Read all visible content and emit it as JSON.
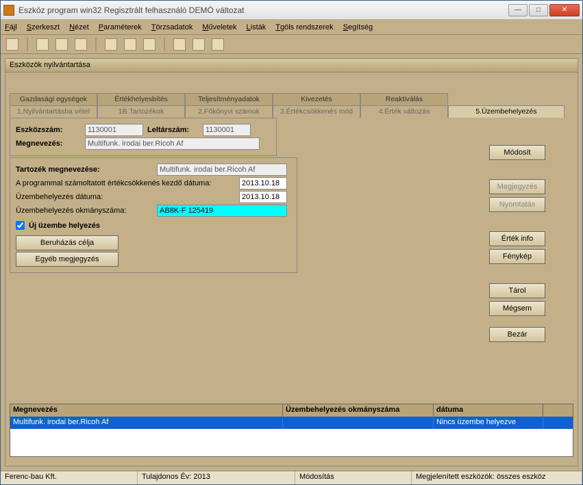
{
  "window": {
    "title": "Eszköz program win32 Regisztrált felhasználó  DEMÓ változat"
  },
  "menu": {
    "items": [
      {
        "u": "F",
        "rest": "ájl"
      },
      {
        "u": "S",
        "rest": "zerkeszt"
      },
      {
        "u": "N",
        "rest": "ézet"
      },
      {
        "u": "P",
        "rest": "araméterek"
      },
      {
        "u": "T",
        "rest": "örzsadatok"
      },
      {
        "u": "M",
        "rest": "űveletek"
      },
      {
        "u": "L",
        "rest": "isták"
      },
      {
        "u": "T",
        "rest": "göls rendszerek"
      },
      {
        "u": "S",
        "rest": "egítség"
      }
    ]
  },
  "panel": {
    "title": "Eszközök nyilvántartása"
  },
  "tabs_row1": [
    "Gazdasági egységek",
    "Értékhelyesbítés",
    "Teljesítményadatok",
    "Kivezetés",
    "Reaktiválás"
  ],
  "tabs_row2": [
    "1.Nyilvántartásba vétel",
    "1B.Tartozékok",
    "2.Főkönyvi számok",
    "3.Értékcsökkenés mód",
    "4.Érték változás",
    "5.Üzembehelyezés"
  ],
  "form": {
    "eszkozszam_lbl": "Eszközszám:",
    "eszkozszam_val": "1130001",
    "leltarszam_lbl": "Leltárszám:",
    "leltarszam_val": "1130001",
    "megnevezes_lbl": "Megnevezés:",
    "megnevezes_val": "Multifunk. irodai ber.Ricoh Af",
    "tartozek_lbl": "Tartozék megnevezése:",
    "tartozek_val": "Multifunk. irodai ber.Ricoh Af",
    "prg_lbl": "A programmal számoltatott értékcsökkenés kezdő dátuma:",
    "prg_val": "2013.10.18",
    "uzdat_lbl": "Üzembehelyezés dátuma:",
    "uzdat_val": "2013.10.18",
    "okm_lbl": "Üzembehelyezés okmányszáma:",
    "okm_val": "AB8K-F 125419",
    "chk_lbl": "Új üzembe helyezés",
    "beruhazas": "Beruházás célja",
    "egyeb": "Egyéb megjegyzés"
  },
  "rbuttons": {
    "modosit": "Módosít",
    "megjegyzes": "Megjegyzés",
    "nyomtatas": "Nyomtatás",
    "ertek": "Érték info",
    "fenykep": "Fénykép",
    "tarol": "Tárol",
    "megsem": "Mégsem",
    "bezar": "Bezár"
  },
  "grid": {
    "cols": [
      "Megnevezés",
      "Üzembehelyezés okmányszáma",
      "dátuma"
    ],
    "row": {
      "meg": "Multifunk. irodai ber.Ricoh Af",
      "okm": "",
      "dat": "Nincs üzembe helyezve"
    }
  },
  "status": {
    "s1": "Ferenc-bau Kft.",
    "s2": "Tulajdonos Év: 2013",
    "s3": "Módosítás",
    "s4": "Megjelenített eszközök: összes eszköz"
  }
}
